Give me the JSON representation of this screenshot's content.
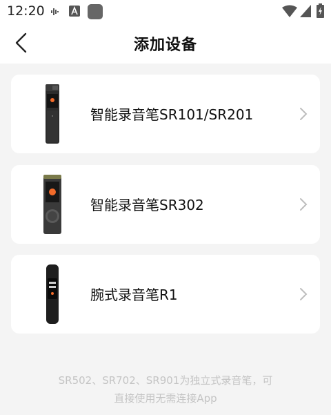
{
  "status_bar": {
    "time": "12:20",
    "icons": [
      "signal-wave-icon",
      "font-app-icon",
      "app-square-icon",
      "wifi-icon",
      "cellular-icon",
      "battery-charging-icon"
    ]
  },
  "header": {
    "back_icon": "chevron-left-icon",
    "title": "添加设备"
  },
  "devices": [
    {
      "label": "智能录音笔SR101/SR201",
      "icon": "recorder-sr101-image"
    },
    {
      "label": "智能录音笔SR302",
      "icon": "recorder-sr302-image"
    },
    {
      "label": "腕式录音笔R1",
      "icon": "wrist-recorder-r1-image"
    }
  ],
  "footer": {
    "line1": "SR502、SR702、SR901为独立式录音笔，可",
    "line2": "直接使用无需连接App"
  },
  "colors": {
    "background": "#f4f4f4",
    "card": "#ffffff",
    "text": "#111111",
    "hint_text": "#c4c4c4",
    "chevron": "#bdbdbd",
    "accent_orange": "#f26b2a"
  }
}
